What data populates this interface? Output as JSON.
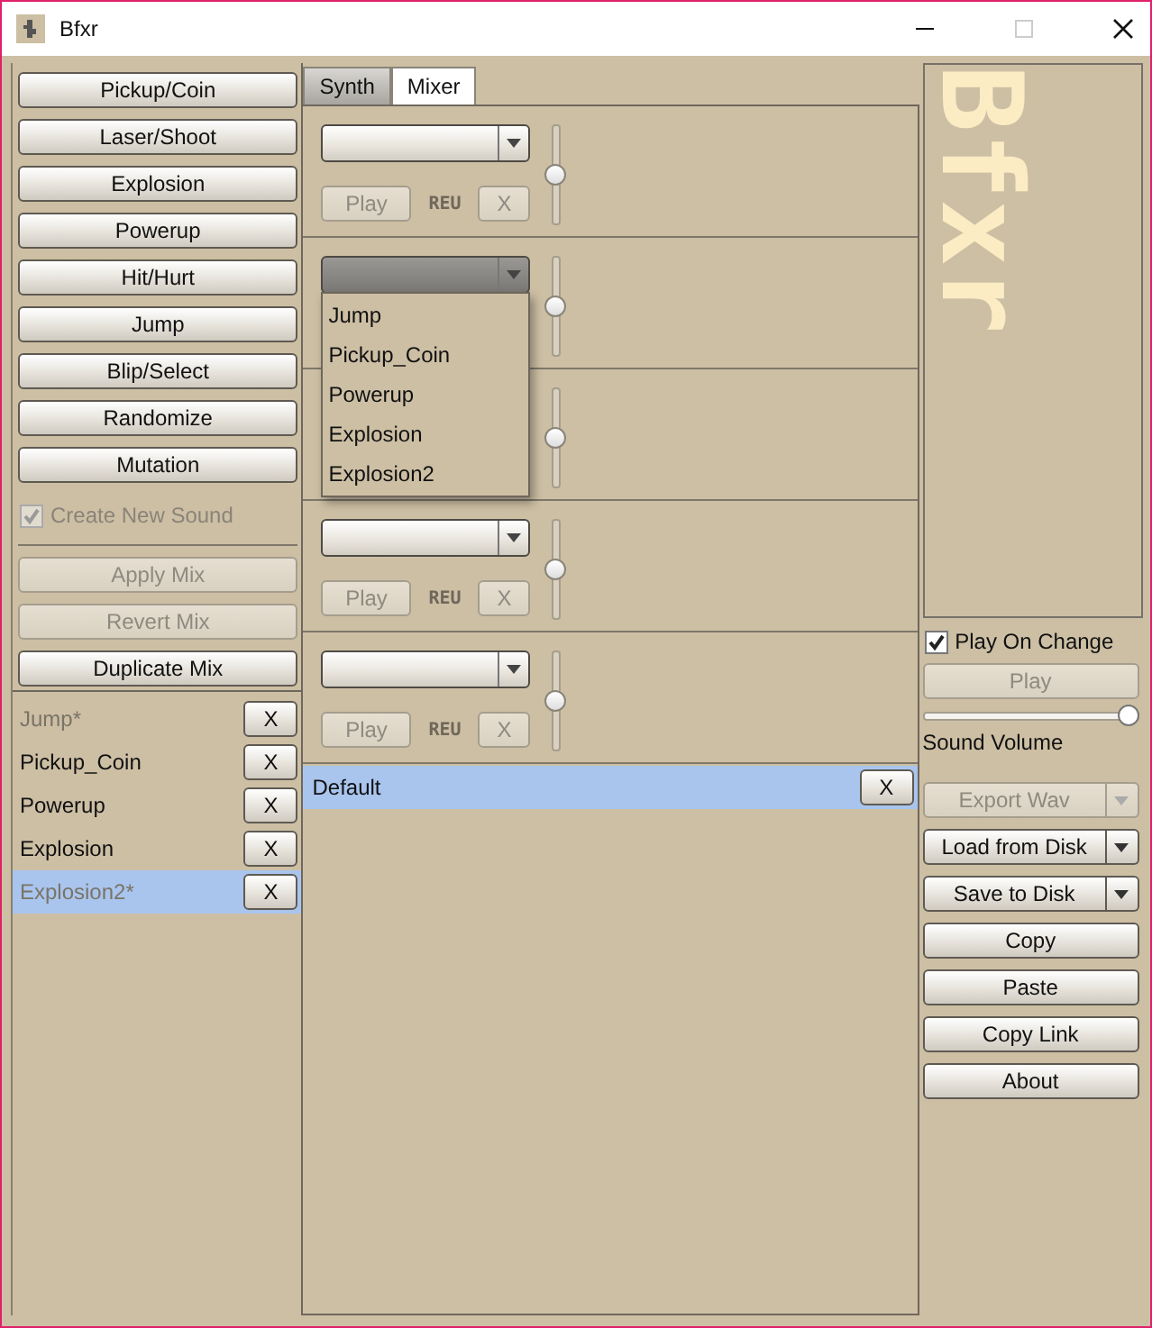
{
  "window": {
    "title": "Bfxr"
  },
  "generators": [
    "Pickup/Coin",
    "Laser/Shoot",
    "Explosion",
    "Powerup",
    "Hit/Hurt",
    "Jump",
    "Blip/Select",
    "Randomize",
    "Mutation"
  ],
  "create_new_sound": {
    "label": "Create New Sound",
    "checked": true,
    "disabled": true
  },
  "mix_buttons": [
    {
      "label": "Apply Mix",
      "disabled": true
    },
    {
      "label": "Revert Mix",
      "disabled": true
    },
    {
      "label": "Duplicate Mix",
      "disabled": false
    }
  ],
  "sounds": [
    {
      "name": "Jump*",
      "modified": true,
      "selected": false,
      "remove": "X"
    },
    {
      "name": "Pickup_Coin",
      "modified": false,
      "selected": false,
      "remove": "X"
    },
    {
      "name": "Powerup",
      "modified": false,
      "selected": false,
      "remove": "X"
    },
    {
      "name": "Explosion",
      "modified": false,
      "selected": false,
      "remove": "X"
    },
    {
      "name": "Explosion2*",
      "modified": true,
      "selected": true,
      "remove": "X"
    }
  ],
  "tabs": [
    {
      "label": "Synth",
      "selected": false
    },
    {
      "label": "Mixer",
      "selected": true
    }
  ],
  "tracks": [
    {
      "dropdown": {
        "open": false
      },
      "level": 0.5,
      "buttons": {
        "play": "Play",
        "reverse": "REU",
        "remove": "X",
        "disabled": true
      }
    },
    {
      "dropdown": {
        "open": true
      },
      "level": 0.5,
      "menu": [
        "Jump",
        "Pickup_Coin",
        "Powerup",
        "Explosion",
        "Explosion2"
      ]
    },
    {
      "level": 0.5
    },
    {
      "dropdown": {
        "open": false
      },
      "level": 0.5,
      "buttons": {
        "play": "Play",
        "reverse": "REU",
        "remove": "X",
        "disabled": true
      }
    },
    {
      "dropdown": {
        "open": false
      },
      "level": 0.5,
      "buttons": {
        "play": "Play",
        "reverse": "REU",
        "remove": "X",
        "disabled": true
      }
    }
  ],
  "mixes": [
    {
      "name": "Default",
      "selected": true,
      "remove": "X"
    }
  ],
  "logo": "Bfxr",
  "play_on_change": {
    "label": "Play On Change",
    "checked": true
  },
  "play_button": {
    "label": "Play",
    "disabled": true
  },
  "volume": {
    "level": 1,
    "label": "Sound Volume"
  },
  "file_buttons": [
    {
      "label": "Export Wav",
      "kind": "split",
      "disabled": true
    },
    {
      "label": "Load from Disk",
      "kind": "split",
      "disabled": false
    },
    {
      "label": "Save to Disk",
      "kind": "split",
      "disabled": false
    },
    {
      "label": "Copy",
      "kind": "plain",
      "disabled": false
    },
    {
      "label": "Paste",
      "kind": "plain",
      "disabled": false
    },
    {
      "label": "Copy Link",
      "kind": "plain",
      "disabled": false
    },
    {
      "label": "About",
      "kind": "plain",
      "disabled": false
    }
  ]
}
